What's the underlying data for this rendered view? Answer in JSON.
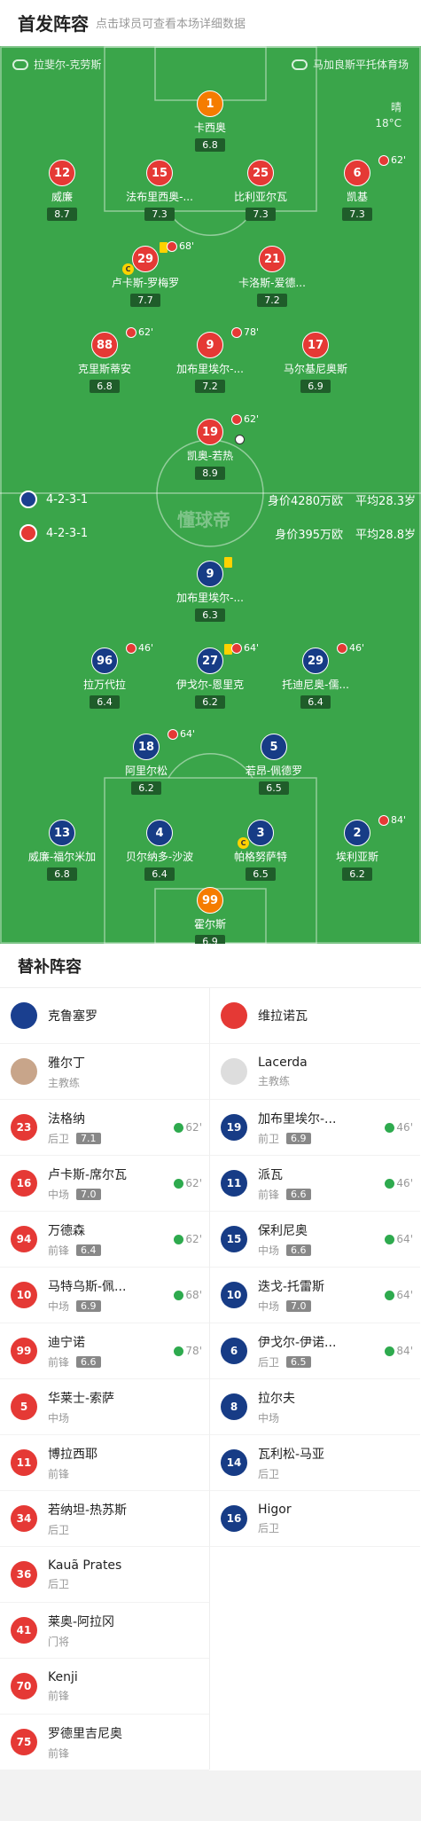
{
  "header": {
    "title": "首发阵容",
    "subtitle": "点击球员可查看本场详细数据"
  },
  "pitch": {
    "home_venue_team": "拉斐尔-克劳斯",
    "stadium": "马加良斯平托体育场",
    "weather": "晴",
    "temp": "18°C",
    "home_team_formation": "4-2-3-1",
    "home_team_value": "身价4280万欧",
    "home_team_age": "平均28.3岁",
    "away_team_formation": "4-2-3-1",
    "away_team_value": "身价395万欧",
    "away_team_age": "平均28.8岁",
    "logo": "懂球帝"
  },
  "home_players": [
    {
      "num": "1",
      "name": "卡西奥",
      "rate": "6.8"
    },
    {
      "num": "12",
      "name": "威廉",
      "rate": "8.7"
    },
    {
      "num": "15",
      "name": "法布里西奥-...",
      "rate": "7.3"
    },
    {
      "num": "25",
      "name": "比利亚尔瓦",
      "rate": "7.3"
    },
    {
      "num": "6",
      "name": "凯基",
      "rate": "7.3",
      "sub": "62'"
    },
    {
      "num": "29",
      "name": "卢卡斯-罗梅罗",
      "rate": "7.7",
      "sub": "68'"
    },
    {
      "num": "21",
      "name": "卡洛斯-爱德...",
      "rate": "7.2"
    },
    {
      "num": "88",
      "name": "克里斯蒂安",
      "rate": "6.8",
      "sub": "62'"
    },
    {
      "num": "9",
      "name": "加布里埃尔-...",
      "rate": "7.2",
      "sub": "78'"
    },
    {
      "num": "17",
      "name": "马尔基尼奥斯",
      "rate": "6.9"
    },
    {
      "num": "19",
      "name": "凯奥-若热",
      "rate": "8.9",
      "sub": "62'"
    }
  ],
  "away_players": [
    {
      "num": "9",
      "name": "加布里埃尔-...",
      "rate": "6.3"
    },
    {
      "num": "96",
      "name": "拉万代拉",
      "rate": "6.4",
      "sub": "46'"
    },
    {
      "num": "27",
      "name": "伊戈尔-恩里克",
      "rate": "6.2",
      "sub": "64'"
    },
    {
      "num": "29",
      "name": "托迪尼奥-儒...",
      "rate": "6.4",
      "sub": "46'"
    },
    {
      "num": "18",
      "name": "阿里尔松",
      "rate": "6.2",
      "sub": "64'"
    },
    {
      "num": "5",
      "name": "若昂-佩德罗",
      "rate": "6.5"
    },
    {
      "num": "13",
      "name": "威廉-福尔米加",
      "rate": "6.8"
    },
    {
      "num": "4",
      "name": "贝尔纳多-沙波",
      "rate": "6.4"
    },
    {
      "num": "3",
      "name": "帕格努萨特",
      "rate": "6.5"
    },
    {
      "num": "2",
      "name": "埃利亚斯",
      "rate": "6.2",
      "sub": "84'"
    },
    {
      "num": "99",
      "name": "霍尔斯",
      "rate": "6.9"
    }
  ],
  "subs": {
    "title": "替补阵容",
    "home": {
      "club": "克鲁塞罗",
      "coach": "雅尔丁",
      "coach_role": "主教练",
      "players": [
        {
          "num": "23",
          "name": "法格纳",
          "pos": "后卫",
          "rate": "7.1",
          "min": "62'"
        },
        {
          "num": "16",
          "name": "卢卡斯-席尔瓦",
          "pos": "中场",
          "rate": "7.0",
          "min": "62'"
        },
        {
          "num": "94",
          "name": "万德森",
          "pos": "前锋",
          "rate": "6.4",
          "min": "62'"
        },
        {
          "num": "10",
          "name": "马特乌斯-佩...",
          "pos": "中场",
          "rate": "6.9",
          "min": "68'"
        },
        {
          "num": "99",
          "name": "迪宁诺",
          "pos": "前锋",
          "rate": "6.6",
          "min": "78'"
        },
        {
          "num": "5",
          "name": "华莱士-索萨",
          "pos": "中场"
        },
        {
          "num": "11",
          "name": "博拉西耶",
          "pos": "前锋"
        },
        {
          "num": "34",
          "name": "若纳坦-热苏斯",
          "pos": "后卫"
        },
        {
          "num": "36",
          "name": "Kauã Prates",
          "pos": "后卫"
        },
        {
          "num": "41",
          "name": "莱奥-阿拉冈",
          "pos": "门将"
        },
        {
          "num": "70",
          "name": "Kenji",
          "pos": "前锋"
        },
        {
          "num": "75",
          "name": "罗德里吉尼奥",
          "pos": "前锋"
        }
      ]
    },
    "away": {
      "club": "维拉诺瓦",
      "coach": "Lacerda",
      "coach_role": "主教练",
      "players": [
        {
          "num": "19",
          "name": "加布里埃尔-...",
          "pos": "前卫",
          "rate": "6.9",
          "min": "46'"
        },
        {
          "num": "11",
          "name": "派瓦",
          "pos": "前锋",
          "rate": "6.6",
          "min": "46'"
        },
        {
          "num": "15",
          "name": "保利尼奥",
          "pos": "中场",
          "rate": "6.6",
          "min": "64'"
        },
        {
          "num": "10",
          "name": "迭戈-托雷斯",
          "pos": "中场",
          "rate": "7.0",
          "min": "64'"
        },
        {
          "num": "6",
          "name": "伊戈尔-伊诺...",
          "pos": "后卫",
          "rate": "6.5",
          "min": "84'"
        },
        {
          "num": "8",
          "name": "拉尔夫",
          "pos": "中场"
        },
        {
          "num": "14",
          "name": "瓦利松-马亚",
          "pos": "后卫"
        },
        {
          "num": "16",
          "name": "Higor",
          "pos": "后卫"
        }
      ]
    }
  },
  "colors": {
    "pitch": "#3aa54a",
    "home": "#e53935",
    "away": "#173c86",
    "gk": "#f57c00"
  }
}
